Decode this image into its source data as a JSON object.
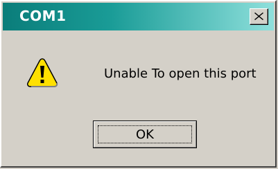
{
  "window": {
    "title": "COM1",
    "message": "Unable To open this port",
    "ok_label": "OK"
  },
  "colors": {
    "titlebar_start": "#0a7d7a",
    "titlebar_end": "#8fe0dc",
    "face": "#d4d0c8",
    "warning_yellow": "#ffe000"
  },
  "icons": {
    "warning": "warning-icon",
    "close": "close-icon"
  }
}
